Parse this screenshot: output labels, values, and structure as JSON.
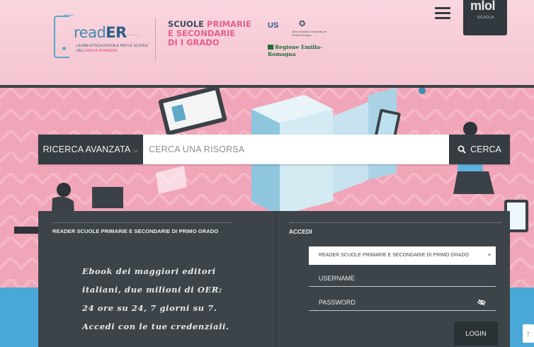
{
  "header": {
    "logo": {
      "word_prefix": "read",
      "word_suffix": "ER",
      "tagline_part1": "La biblioteca digitale per le scuole dell'",
      "tagline_highlight": "Emilia-Romagna"
    },
    "school_line1": "Scuole ",
    "school_line1_highlight": "primarie",
    "school_line2": "e secondarie",
    "school_line3": "di I grado",
    "institution": {
      "us_mark": "US",
      "office_text": "Ufficio Scolastico Regionale per l'Emilia-Romagna",
      "region_text": "Regione Emilia-Romagna"
    },
    "mlol": {
      "word": "mlol",
      "sub": "SCUOLA"
    }
  },
  "search": {
    "advanced_label": "RICERCA AVANZATA",
    "placeholder": "CERCA UNA RISORSA",
    "button_label": "CERCA"
  },
  "panel": {
    "left_title": "READER SCUOLE PRIMARIE E SECONDARIE DI PRIMO GRADO",
    "description": "Ebook dei maggiori editori italiani, due milioni di OER: 24 ore su 24, 7 giorni su 7. Accedi con le tue credenziali.",
    "login_title": "ACCEDI",
    "select_value": "READER SCUOLE PRIMARIE E SECONDARIE DI PRIMO GRADO",
    "username_placeholder": "USERNAME",
    "password_placeholder": "PASSWORD",
    "login_button": "LOGIN"
  },
  "scroll_top_glyph": "↑"
}
